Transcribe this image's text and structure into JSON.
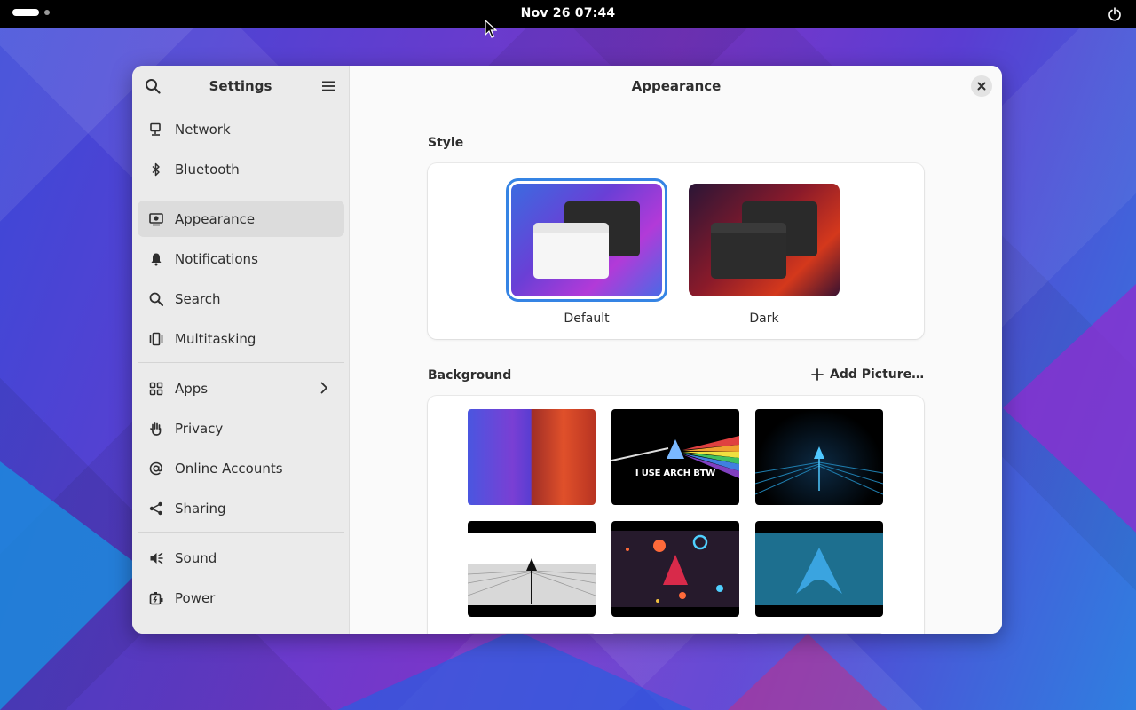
{
  "topbar": {
    "clock": "Nov 26  07:44"
  },
  "window": {
    "sidebar": {
      "title": "Settings",
      "groups": [
        [
          {
            "label": "Network",
            "icon": "network-icon"
          },
          {
            "label": "Bluetooth",
            "icon": "bluetooth-icon"
          }
        ],
        [
          {
            "label": "Appearance",
            "icon": "appearance-icon",
            "active": true
          },
          {
            "label": "Notifications",
            "icon": "bell-icon"
          },
          {
            "label": "Search",
            "icon": "search-icon"
          },
          {
            "label": "Multitasking",
            "icon": "multitasking-icon"
          }
        ],
        [
          {
            "label": "Apps",
            "icon": "apps-grid-icon",
            "chevron": true
          },
          {
            "label": "Privacy",
            "icon": "hand-icon"
          },
          {
            "label": "Online Accounts",
            "icon": "at-sign-icon"
          },
          {
            "label": "Sharing",
            "icon": "share-icon"
          }
        ],
        [
          {
            "label": "Sound",
            "icon": "speaker-icon"
          },
          {
            "label": "Power",
            "icon": "battery-icon"
          }
        ]
      ]
    },
    "content": {
      "title": "Appearance",
      "style": {
        "label": "Style",
        "options": [
          {
            "label": "Default",
            "selected": true
          },
          {
            "label": "Dark",
            "selected": false
          }
        ]
      },
      "background": {
        "label": "Background",
        "add_label": "Add Picture…",
        "thumbnails": [
          {
            "name": "bg-split-blue-red"
          },
          {
            "name": "bg-arch-prism",
            "text": "I USE ARCH BTW"
          },
          {
            "name": "bg-arch-grid-dark"
          },
          {
            "name": "bg-arch-white-road"
          },
          {
            "name": "bg-arch-planets"
          },
          {
            "name": "bg-arch-teal"
          }
        ]
      }
    }
  },
  "colors": {
    "accent": "#3584e4"
  }
}
